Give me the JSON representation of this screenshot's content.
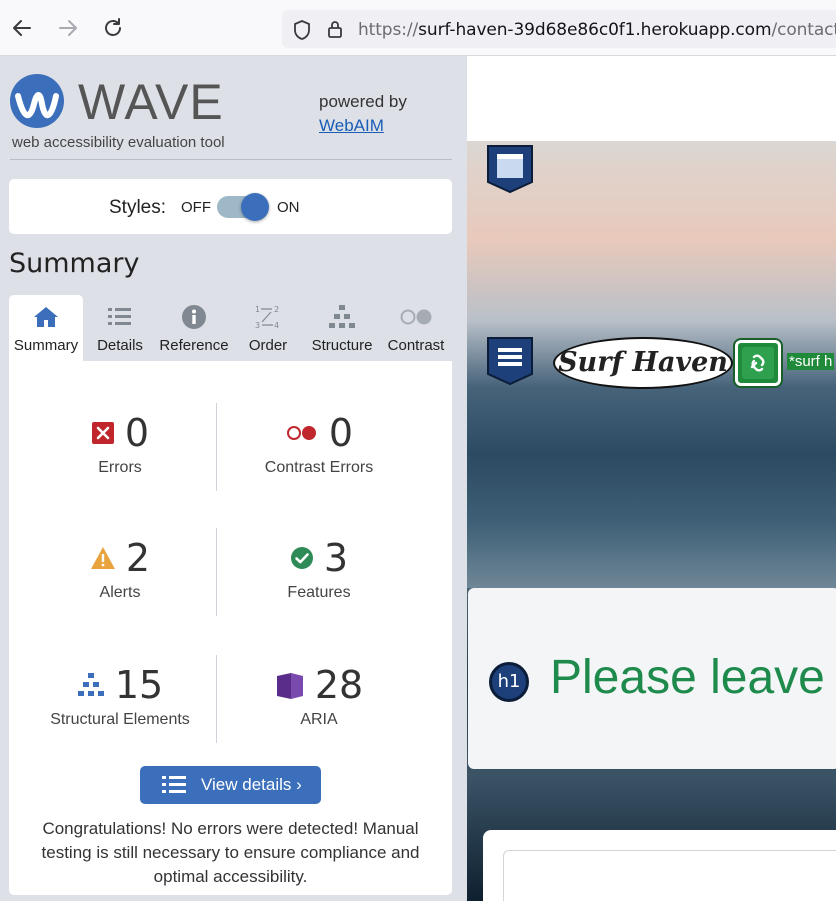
{
  "browser": {
    "url_prefix": "https://",
    "url_host": "surf-haven-39d68e86c0f1.herokuapp.com",
    "url_path": "/contact/"
  },
  "wave": {
    "logo_word": "WAVE",
    "tagline": "web accessibility evaluation tool",
    "powered_by": "powered by",
    "webaim_link": "WebAIM",
    "styles": {
      "label": "Styles:",
      "off": "OFF",
      "on": "ON",
      "state": "on"
    },
    "summary_title": "Summary",
    "tabs": [
      {
        "label": "Summary",
        "icon": "home-icon",
        "active": true
      },
      {
        "label": "Details",
        "icon": "list-icon"
      },
      {
        "label": "Reference",
        "icon": "info-icon"
      },
      {
        "label": "Order",
        "icon": "order-icon"
      },
      {
        "label": "Structure",
        "icon": "structure-icon"
      },
      {
        "label": "Contrast",
        "icon": "contrast-icon"
      }
    ],
    "stats": {
      "errors": {
        "value": "0",
        "label": "Errors",
        "color": "#c0272d"
      },
      "contrast_errors": {
        "value": "0",
        "label": "Contrast Errors",
        "color": "#c0272d"
      },
      "alerts": {
        "value": "2",
        "label": "Alerts",
        "color": "#e8a33d"
      },
      "features": {
        "value": "3",
        "label": "Features",
        "color": "#2e8b57"
      },
      "structural": {
        "value": "15",
        "label": "Structural Elements",
        "color": "#3b6fbb"
      },
      "aria": {
        "value": "28",
        "label": "ARIA",
        "color": "#5b2d8a"
      }
    },
    "view_details": "View details ›",
    "congrats": "Congratulations! No errors were detected! Manual testing is still necessary to ensure compliance and optimal accessibility."
  },
  "page": {
    "logo_text": "Surf Haven",
    "alt_text": "*surf h",
    "h1_badge": "h1",
    "heading": "Please leave"
  },
  "colors": {
    "wave_blue": "#3b6fbb",
    "sidebar_bg": "#dde1e7",
    "heading_green": "#1e8a4c"
  }
}
